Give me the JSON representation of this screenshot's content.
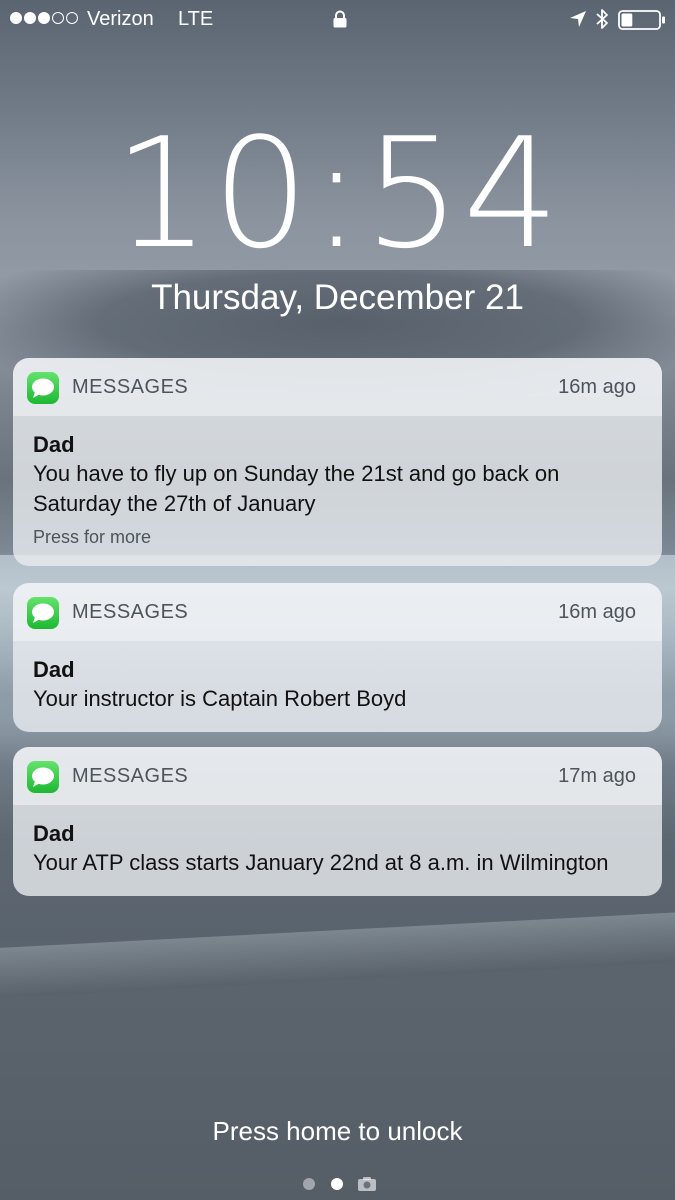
{
  "status_bar": {
    "signal_strength": 3,
    "signal_max": 5,
    "carrier": "Verizon",
    "network": "LTE",
    "icons": [
      "lock-icon",
      "location-arrow-icon",
      "bluetooth-icon",
      "battery-icon"
    ],
    "battery_level": 0.3
  },
  "lock_screen": {
    "time": "10:54",
    "date": "Thursday, December 21",
    "unlock_hint": "Press home to unlock",
    "page_indicator": {
      "pages": 3,
      "current": 2,
      "last_icon": "camera-icon"
    }
  },
  "notifications": [
    {
      "app": "MESSAGES",
      "app_icon": "messages-icon",
      "time": "16m ago",
      "sender": "Dad",
      "message": "You have to fly up on Sunday the 21st and go back on Saturday the 27th of January",
      "more": "Press for more"
    },
    {
      "app": "MESSAGES",
      "app_icon": "messages-icon",
      "time": "16m ago",
      "sender": "Dad",
      "message": "Your instructor is Captain Robert Boyd"
    },
    {
      "app": "MESSAGES",
      "app_icon": "messages-icon",
      "time": "17m ago",
      "sender": "Dad",
      "message": "Your ATP class starts January 22nd at 8 a.m. in Wilmington"
    }
  ],
  "colors": {
    "notification_bg": "#e8ecf0",
    "messages_green": "#34c84a",
    "text_secondary": "#4c545c"
  }
}
